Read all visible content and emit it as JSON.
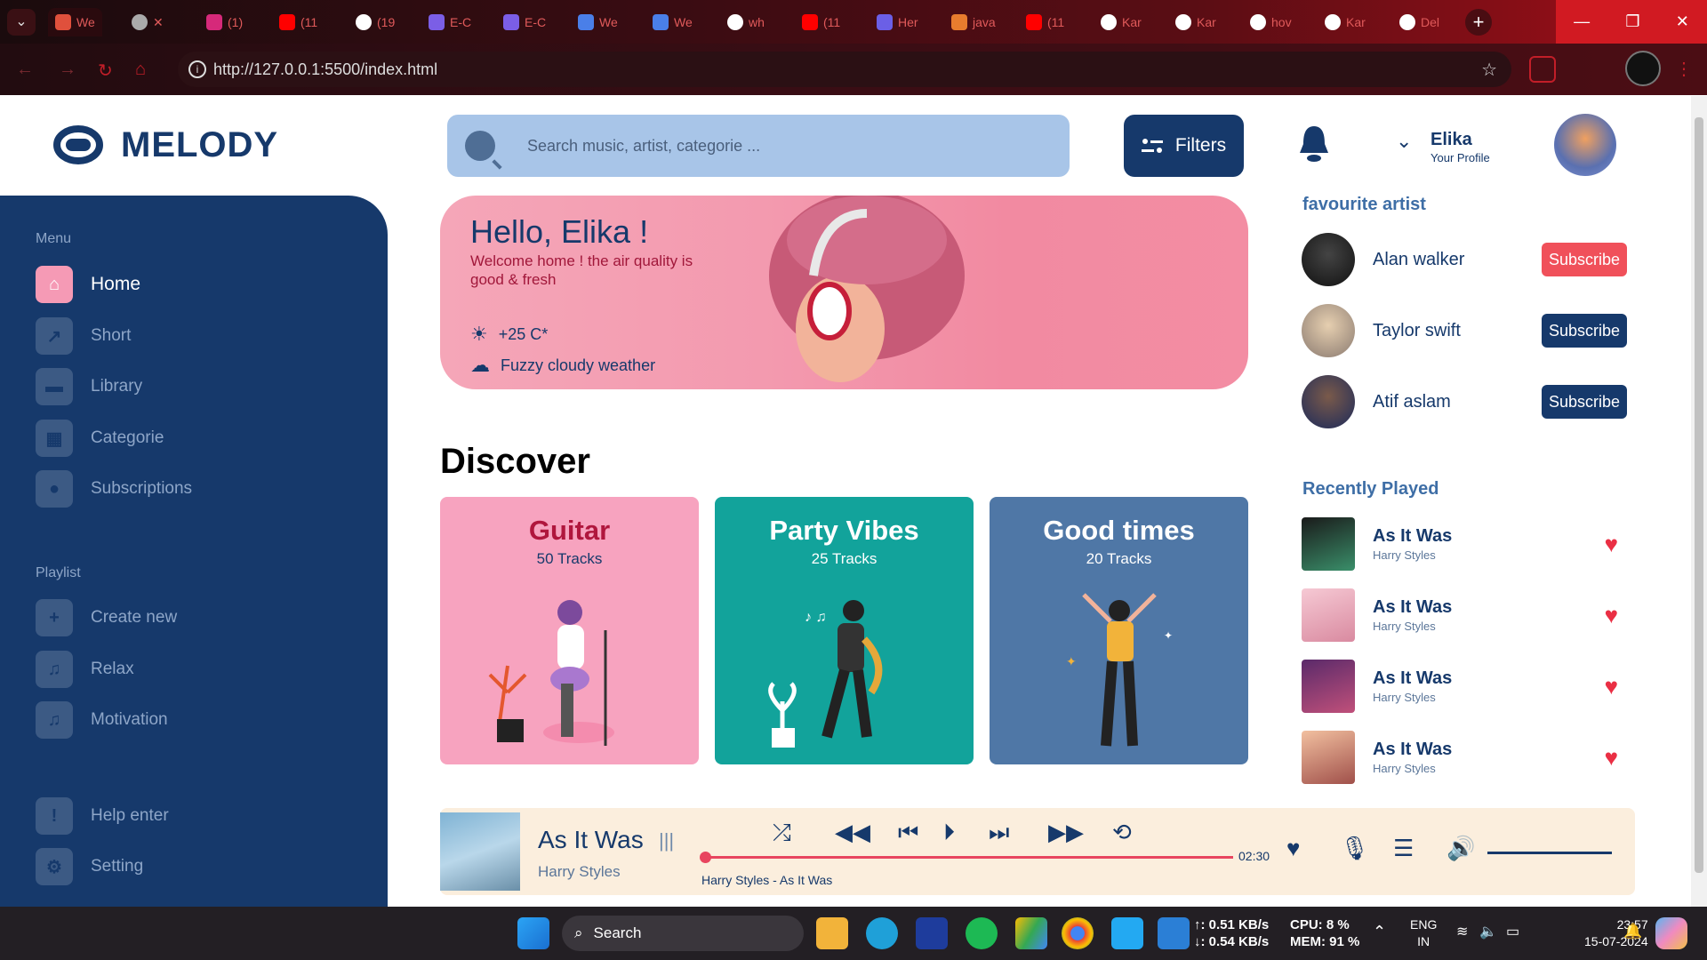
{
  "browser": {
    "tabs": [
      "We",
      "",
      "(1)",
      "(11",
      "(19",
      "E-C",
      "E-C",
      "We",
      "We",
      "wh",
      "(11",
      "Her",
      "java",
      "(11",
      "Kar",
      "Kar",
      "hov",
      "Kar",
      "Del"
    ],
    "url": "http://127.0.0.1:5500/index.html"
  },
  "app": {
    "name": "MELODY",
    "search_placeholder": "Search music, artist, categorie ...",
    "filters_label": "Filters",
    "user": {
      "name": "Elika",
      "subtitle": "Your Profile"
    }
  },
  "sidebar": {
    "menu_heading": "Menu",
    "menu": [
      {
        "label": "Home",
        "icon": "home-icon",
        "active": true
      },
      {
        "label": "Short",
        "icon": "chart-icon",
        "active": false
      },
      {
        "label": "Library",
        "icon": "folder-icon",
        "active": false
      },
      {
        "label": "Categorie",
        "icon": "grid-icon",
        "active": false
      },
      {
        "label": "Subscriptions",
        "icon": "users-icon",
        "active": false
      }
    ],
    "playlist_heading": "Playlist",
    "playlist": [
      {
        "label": "Create new",
        "icon": "plus-icon"
      },
      {
        "label": "Relax",
        "icon": "music-icon"
      },
      {
        "label": "Motivation",
        "icon": "music-icon"
      }
    ],
    "footer": [
      {
        "label": "Help enter",
        "icon": "alert-icon"
      },
      {
        "label": "Setting",
        "icon": "gear-icon"
      }
    ]
  },
  "hero": {
    "greeting": "Hello, Elika !",
    "message": "Welcome home ! the air quality is good & fresh",
    "temperature": "+25 C*",
    "weather": "Fuzzy cloudy weather"
  },
  "discover": {
    "title": "Discover",
    "cards": [
      {
        "title": "Guitar",
        "tracks": "50 Tracks",
        "bg": "#f7a3bf",
        "color": "#b0163d"
      },
      {
        "title": "Party Vibes",
        "tracks": "25 Tracks",
        "bg": "#12a39b",
        "color": "#ffffff"
      },
      {
        "title": "Good times",
        "tracks": "20 Tracks",
        "bg": "#4f77a6",
        "color": "#ffffff"
      }
    ]
  },
  "favourite": {
    "title": "favourite artist",
    "artists": [
      {
        "name": "Alan walker",
        "button": "Subscribe",
        "button_color": "#f0505a"
      },
      {
        "name": "Taylor swift",
        "button": "Subscribe",
        "button_color": "#16396b"
      },
      {
        "name": "Atif aslam",
        "button": "Subscribe",
        "button_color": "#16396b"
      }
    ]
  },
  "recent": {
    "title": "Recently Played",
    "tracks": [
      {
        "title": "As It Was",
        "artist": "Harry Styles"
      },
      {
        "title": "As It Was",
        "artist": "Harry Styles"
      },
      {
        "title": "As It Was",
        "artist": "Harry Styles"
      },
      {
        "title": "As It Was",
        "artist": "Harry Styles"
      }
    ]
  },
  "player": {
    "title": "As It Was",
    "artist": "Harry Styles",
    "time": "02:30",
    "caption": "Harry Styles - As It Was",
    "progress": 0.0
  },
  "taskbar": {
    "search": "Search",
    "net_up": "↑: 0.51 KB/s",
    "net_down": "↓: 0.54 KB/s",
    "cpu": "CPU: 8 %",
    "mem": "MEM: 91 %",
    "lang1": "ENG",
    "lang2": "IN",
    "time": "23:57",
    "date": "15-07-2024"
  }
}
